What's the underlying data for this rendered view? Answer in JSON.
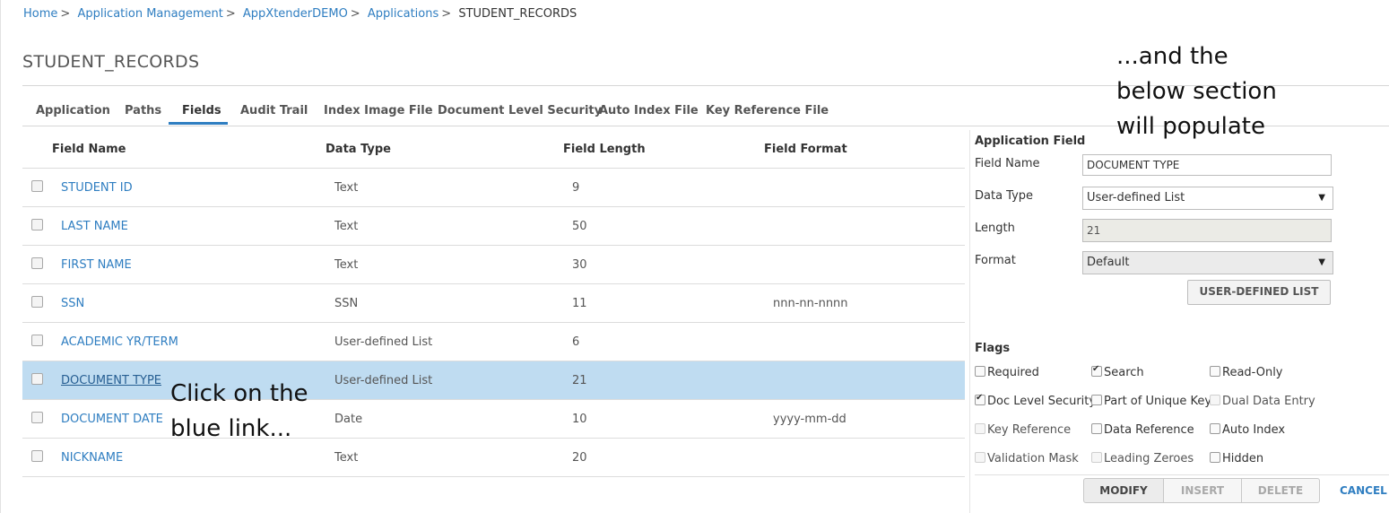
{
  "breadcrumb": {
    "items": [
      "Home",
      "Application Management",
      "AppXtenderDEMO",
      "Applications"
    ],
    "current": "STUDENT_RECORDS"
  },
  "page_title": "STUDENT_RECORDS",
  "tabs": [
    "Application",
    "Paths",
    "Fields",
    "Audit Trail",
    "Index Image File",
    "Document Level Security",
    "Auto Index File",
    "Key Reference File"
  ],
  "active_tab": "Fields",
  "table": {
    "headers": [
      "Field Name",
      "Data Type",
      "Field Length",
      "Field Format"
    ],
    "rows": [
      {
        "name": "STUDENT ID",
        "type": "Text",
        "length": "9",
        "format": ""
      },
      {
        "name": "LAST NAME",
        "type": "Text",
        "length": "50",
        "format": ""
      },
      {
        "name": "FIRST NAME",
        "type": "Text",
        "length": "30",
        "format": ""
      },
      {
        "name": "SSN",
        "type": "SSN",
        "length": "11",
        "format": "nnn-nn-nnnn"
      },
      {
        "name": "ACADEMIC YR/TERM",
        "type": "User-defined List",
        "length": "6",
        "format": ""
      },
      {
        "name": "DOCUMENT TYPE",
        "type": "User-defined List",
        "length": "21",
        "format": ""
      },
      {
        "name": "DOCUMENT DATE",
        "type": "Date",
        "length": "10",
        "format": "yyyy-mm-dd"
      },
      {
        "name": "NICKNAME",
        "type": "Text",
        "length": "20",
        "format": ""
      }
    ],
    "selected_row": "DOCUMENT TYPE"
  },
  "panel": {
    "title": "Application Field",
    "field_name_label": "Field Name",
    "field_name_value": "DOCUMENT TYPE",
    "data_type_label": "Data Type",
    "data_type_value": "User-defined List",
    "length_label": "Length",
    "length_value": "21",
    "format_label": "Format",
    "format_value": "Default",
    "udl_button": "USER-DEFINED LIST",
    "flags_title": "Flags",
    "flags": [
      {
        "label": "Required",
        "checked": false,
        "enabled": true
      },
      {
        "label": "Search",
        "checked": true,
        "enabled": true
      },
      {
        "label": "Read-Only",
        "checked": false,
        "enabled": true
      },
      {
        "label": "Doc Level Security",
        "checked": true,
        "enabled": true
      },
      {
        "label": "Part of Unique Key",
        "checked": false,
        "enabled": true
      },
      {
        "label": "Dual Data Entry",
        "checked": false,
        "enabled": false
      },
      {
        "label": "Key Reference",
        "checked": false,
        "enabled": false
      },
      {
        "label": "Data Reference",
        "checked": false,
        "enabled": true
      },
      {
        "label": "Auto Index",
        "checked": false,
        "enabled": true
      },
      {
        "label": "Validation Mask",
        "checked": false,
        "enabled": false
      },
      {
        "label": "Leading Zeroes",
        "checked": false,
        "enabled": false
      },
      {
        "label": "Hidden",
        "checked": false,
        "enabled": true
      }
    ],
    "buttons": {
      "modify": "MODIFY",
      "insert": "INSERT",
      "delete": "DELETE",
      "cancel": "CANCEL"
    }
  },
  "annotations": {
    "right": [
      "...and the",
      "below section",
      "will populate"
    ],
    "left": [
      "Click on the",
      "blue link..."
    ]
  },
  "colors": {
    "link": "#2f7ec1",
    "selected_row": "#bfdcf1",
    "tab_underline": "#2f7ec1"
  }
}
